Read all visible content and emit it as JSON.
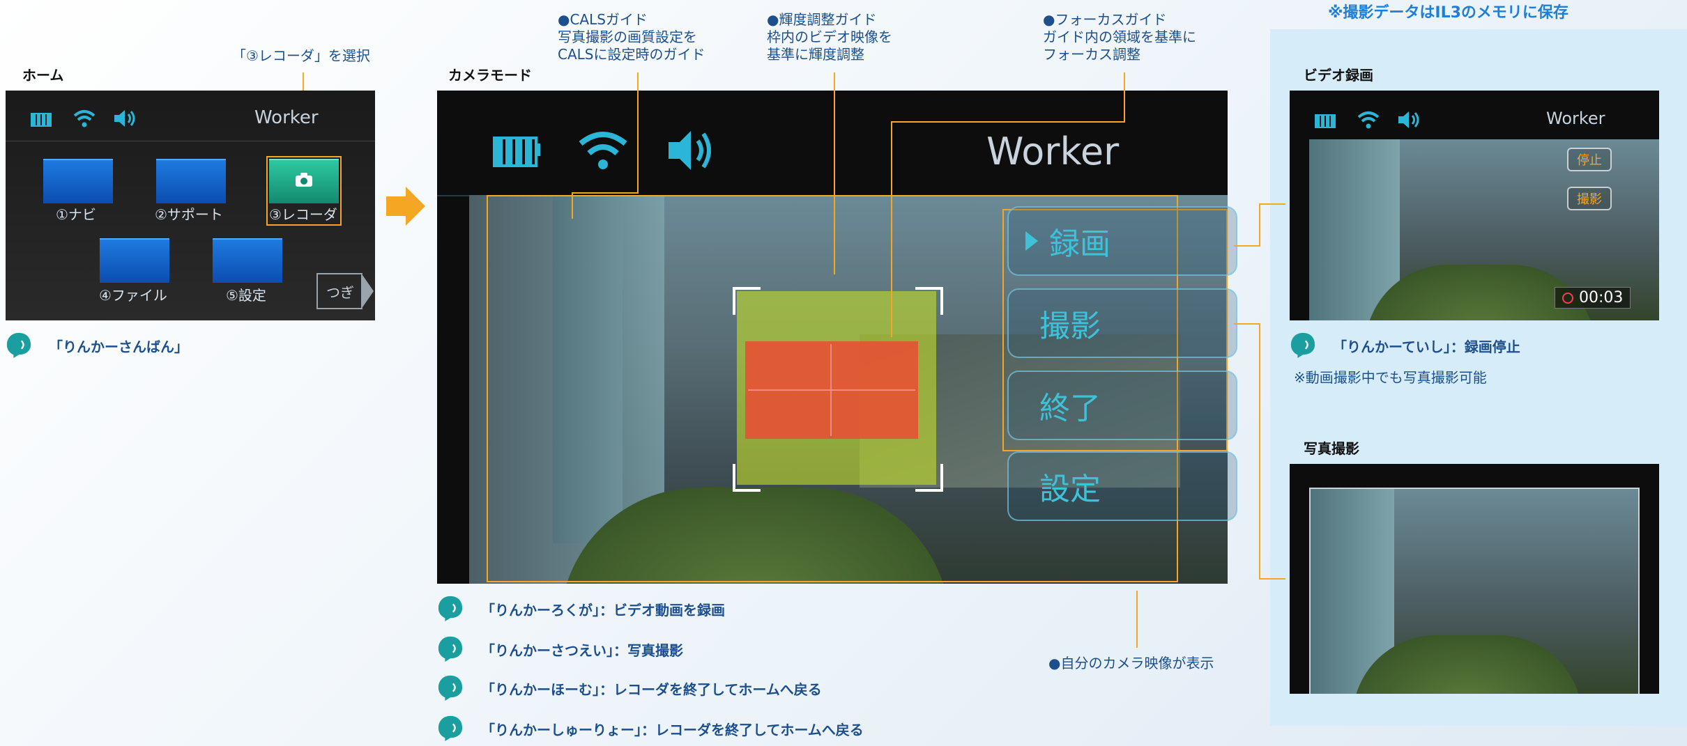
{
  "banner": "※撮影データはIL3のメモリに保存",
  "home": {
    "section_title": "ホーム",
    "annotation": "「③レコーダ」を選択",
    "user": "Worker",
    "tiles": [
      "①ナビ",
      "②サポート",
      "③レコーダ",
      "④ファイル",
      "⑤設定"
    ],
    "next_button": "つぎ",
    "voice_command": "「りんかーさんばん」"
  },
  "camera": {
    "section_title": "カメラモード",
    "user": "Worker",
    "guides": {
      "cals": [
        "●CALSガイド",
        "写真撮影の画質設定を",
        "CALSに設定時のガイド"
      ],
      "brightness": [
        "●輝度調整ガイド",
        "枠内のビデオ映像を",
        "基準に輝度調整"
      ],
      "focus": [
        "●フォーカスガイド",
        "ガイド内の領域を基準に",
        "フォーカス調整"
      ]
    },
    "buttons": [
      "録画",
      "撮影",
      "終了",
      "設定"
    ],
    "own_camera_note": "●自分のカメラ映像が表示",
    "commands": [
      "「りんかーろくが」：ビデオ動画を録画",
      "「りんかーさつえい」：写真撮影",
      "「りんかーほーむ」：レコーダを終了してホームへ戻る",
      "「りんかーしゅーりょー」：レコーダを終了してホームへ戻る"
    ]
  },
  "video": {
    "section_title": "ビデオ録画",
    "user": "Worker",
    "buttons": [
      "停止",
      "撮影"
    ],
    "timer": "00:03",
    "voice_command": "「りんかーていし」：録画停止",
    "note": "※動画撮影中でも写真撮影可能"
  },
  "photo": {
    "section_title": "写真撮影"
  },
  "colors": {
    "accent": "#f5a623",
    "teal": "#1a9ea0",
    "screen": "#0d0d0d",
    "panel": "#d7ecf9",
    "brand_text": "#1c4f8c",
    "banner_text": "#1e7fd8"
  }
}
